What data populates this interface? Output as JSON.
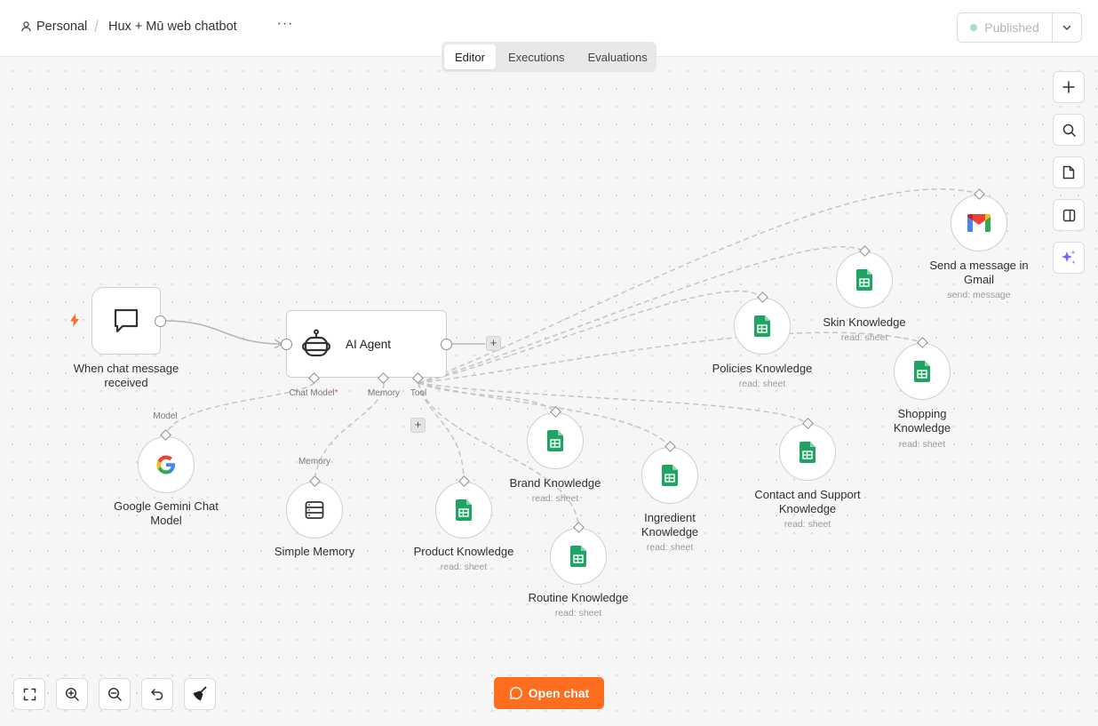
{
  "header": {
    "breadcrumb_personal": "Personal",
    "breadcrumb_separator": "/",
    "workflow_title": "Hux + Mū web chatbot",
    "more_label": "···",
    "status_label": "Published"
  },
  "tabs": [
    {
      "label": "Editor",
      "active": true
    },
    {
      "label": "Executions",
      "active": false
    },
    {
      "label": "Evaluations",
      "active": false
    }
  ],
  "nodes": {
    "chat_trigger": {
      "label": "When chat message received"
    },
    "ai_agent": {
      "label": "AI Agent",
      "port_chat_model": "Chat Model",
      "port_required": "*",
      "port_memory": "Memory",
      "port_tool": "Tool"
    },
    "gemini": {
      "label": "Google Gemini Chat Model",
      "port_label": "Model"
    },
    "simple_memory": {
      "label": "Simple Memory",
      "port_label": "Memory"
    },
    "product_knowledge": {
      "label": "Product Knowledge",
      "sub": "read: sheet"
    },
    "brand_knowledge": {
      "label": "Brand Knowledge",
      "sub": "read: sheet"
    },
    "routine_knowledge": {
      "label": "Routine Knowledge",
      "sub": "read: sheet"
    },
    "ingredient_knowledge": {
      "label": "Ingredient Knowledge",
      "sub": "read: sheet"
    },
    "contact_support_knowledge": {
      "label": "Contact and Support Knowledge",
      "sub": "read: sheet"
    },
    "policies_knowledge": {
      "label": "Policies Knowledge",
      "sub": "read: sheet"
    },
    "skin_knowledge": {
      "label": "Skin Knowledge",
      "sub": "read: sheet"
    },
    "shopping_knowledge": {
      "label": "Shopping Knowledge",
      "sub": "read: sheet"
    },
    "gmail": {
      "label": "Send a message in Gmail",
      "sub": "send: message"
    }
  },
  "controls": {
    "open_chat_label": "Open chat",
    "plus_label": "+"
  },
  "colors": {
    "accent": "#ff6d1f",
    "sheets_green": "#1fa463",
    "published_dot": "#a8dcc4",
    "ai_sparkle": "#8b5cf6"
  }
}
